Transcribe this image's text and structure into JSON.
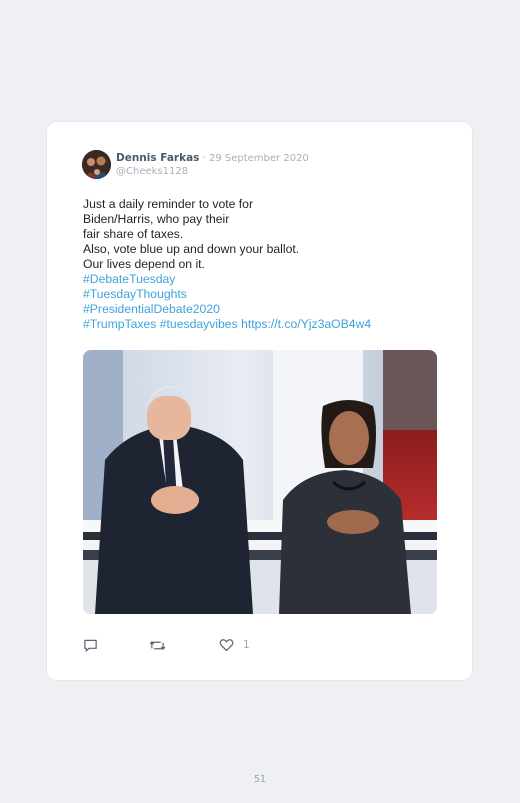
{
  "tweet": {
    "author_name": "Dennis Farkas",
    "separator": " · ",
    "date": "29 September 2020",
    "handle": "@Cheeks1128",
    "text_lines": [
      "Just a daily reminder to vote for",
      "Biden/Harris, who pay their",
      "fair share of taxes.",
      "Also, vote blue up and down your ballot.",
      "Our lives depend on it."
    ],
    "hashtags": {
      "debate_tuesday": "#DebateTuesday",
      "tuesday_thoughts": "#TuesdayThoughts",
      "presidential_debate": "#PresidentialDebate2020",
      "trump_taxes": "#TrumpTaxes",
      "tuesday_vibes": "#tuesdayvibes"
    },
    "link": "https://t.co/Yjz3aOB4w4",
    "like_count": "1"
  },
  "page": {
    "number": "51"
  },
  "icons": {
    "reply": "reply-icon",
    "retweet": "retweet-icon",
    "like": "heart-icon"
  },
  "colors": {
    "hashtag": "#3ea3dc",
    "background": "#eef0f3",
    "card": "#ffffff"
  }
}
